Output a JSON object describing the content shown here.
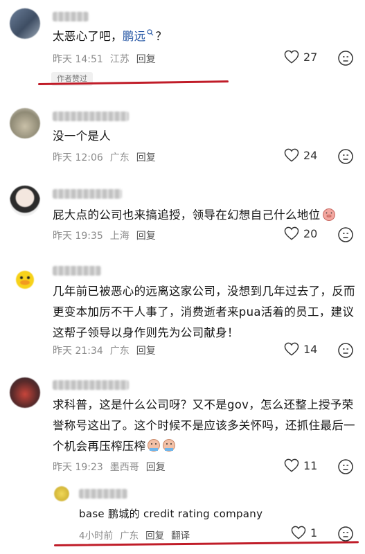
{
  "comments": [
    {
      "text_before": "太恶心了吧，",
      "mention": "鹏远",
      "text_after": "？",
      "time": "昨天 14:51",
      "location": "江苏",
      "reply_label": "回复",
      "likes": "27",
      "badge": "作者赞过"
    },
    {
      "text": "没一个是人",
      "time": "昨天 12:06",
      "location": "广东",
      "reply_label": "回复",
      "likes": "24"
    },
    {
      "text": "屁大点的公司也来搞追授，领导在幻想自己什么地位",
      "time": "昨天 19:35",
      "location": "上海",
      "reply_label": "回复",
      "likes": "20"
    },
    {
      "text": "几年前已被恶心的远离这家公司，没想到几年过去了，反而更变本加厉不干人事了，消费逝者来pua活着的员工，建议这帮子领导以身作则先为公司献身！",
      "time": "昨天 21:34",
      "location": "广东",
      "reply_label": "回复",
      "likes": "14"
    },
    {
      "text": "求科普，这是什么公司呀？又不是gov，怎么还整上授予荣誉称号这出了。这个时候不是应该多关怀吗，还抓住最后一个机会再压榨压榨",
      "time": "昨天 19:23",
      "location": "墨西哥",
      "reply_label": "回复",
      "likes": "11"
    }
  ],
  "reply": {
    "text": "base 鹏城的 credit rating company",
    "time": "4小时前",
    "location": "广东",
    "reply_label": "回复",
    "translate_label": "翻译",
    "likes": "1"
  },
  "icons": {
    "like": "heart-outline-icon",
    "dislike": "frown-face-icon",
    "mention": "search-icon",
    "emoji": "pig-face-emoji"
  },
  "colors": {
    "mention": "#2a5aa6",
    "underline": "#c01c28"
  }
}
